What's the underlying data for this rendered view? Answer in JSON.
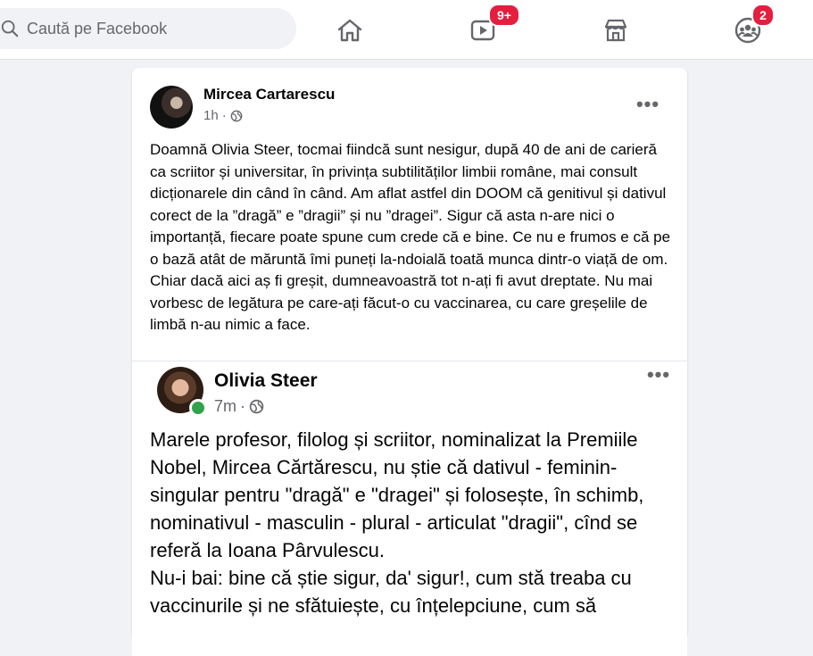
{
  "topbar": {
    "search_placeholder": "Caută pe Facebook",
    "nav": [
      {
        "name": "home-icon"
      },
      {
        "name": "watch-icon",
        "badge": "9+"
      },
      {
        "name": "marketplace-icon"
      },
      {
        "name": "groups-icon",
        "badge": "2"
      }
    ]
  },
  "post": {
    "author": "Mircea Cartarescu",
    "time": "1h",
    "more_icon": "•••",
    "paragraph": "Doamnă Olivia Steer, tocmai fiindcă sunt nesigur, după 40 de ani de carieră ca scriitor și universitar, în privința subtilităților limbii române, mai consult dicționarele din când în când. Am aflat astfel din DOOM că genitivul și dativul corect de la ”dragă” e ”dragii” și nu ”dragei”. Sigur că asta n-are nici o importanță, fiecare poate spune cum crede că e bine. Ce nu e frumos e că pe o bază atât de măruntă îmi puneți la-ndoială toată munca dintr-o viață de om. Chiar dacă aici aș fi greșit, dumneavoastră tot n-ați fi avut dreptate. Nu mai vorbesc de legătura pe care-ați făcut-o cu vaccinarea, cu care greșelile de limbă n-au nimic a face."
  },
  "shared": {
    "author": "Olivia Steer",
    "time": "7m",
    "more_icon": "•••",
    "paragraph1": "Marele profesor, filolog și scriitor, nominalizat la Premiile Nobel, Mircea Cărtărescu, nu știe că dativul - feminin-singular pentru \"dragă\" e \"dragei\" și folosește, în schimb, nominativul -  masculin - plural - articulat \"dragii\", cînd se referă la Ioana Pârvulescu.",
    "paragraph2": "Nu-i bai: bine că știe sigur, da' sigur!, cum stă treaba cu vaccinurile și ne sfătuiește, cu înțelepciune, cum să"
  },
  "colors": {
    "accent": "#1877f2",
    "badge": "#e41e3f",
    "online": "#31a24c",
    "secondary_text": "#65676b"
  }
}
